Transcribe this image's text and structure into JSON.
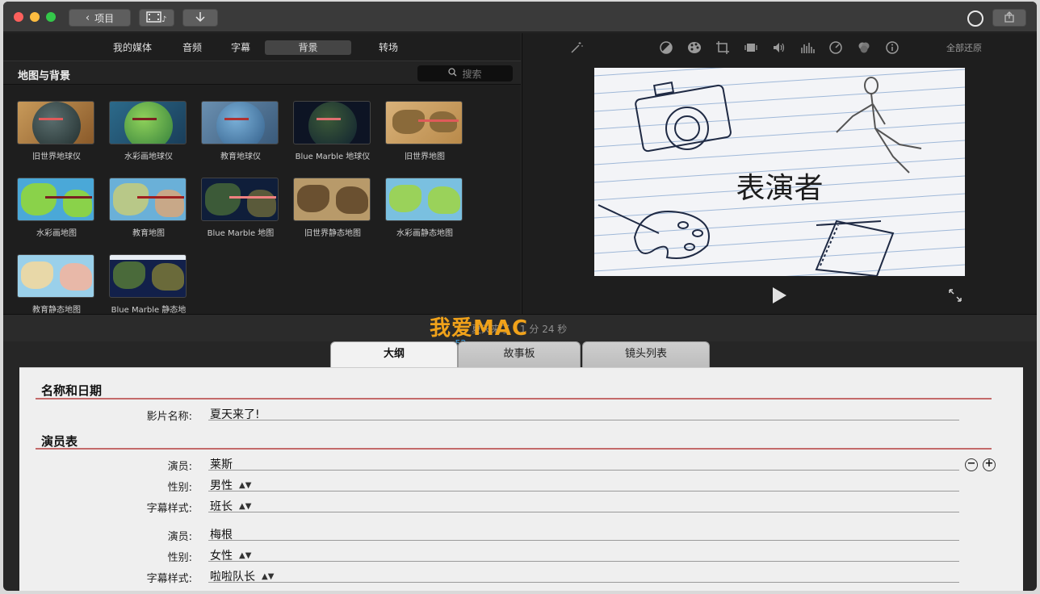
{
  "titlebar": {
    "back_label": "项目",
    "media_icon": "film-music-icon",
    "import_icon": "download-arrow-icon",
    "share_icon": "share-icon"
  },
  "browser": {
    "categories": [
      "我的媒体",
      "音频",
      "字幕",
      "背景",
      "转场"
    ],
    "active_category": "背景",
    "section_title": "地图与背景",
    "search_placeholder": "搜索",
    "tiles": [
      {
        "label": "旧世界地球仪"
      },
      {
        "label": "水彩画地球仪"
      },
      {
        "label": "教育地球仪"
      },
      {
        "label": "Blue Marble 地球仪"
      },
      {
        "label": "旧世界地图"
      },
      {
        "label": "水彩画地图"
      },
      {
        "label": "教育地图"
      },
      {
        "label": "Blue Marble 地图"
      },
      {
        "label": "旧世界静态地图"
      },
      {
        "label": "水彩画静态地图"
      },
      {
        "label": "教育静态地图"
      },
      {
        "label": "Blue Marble 静态地"
      }
    ]
  },
  "viewer": {
    "tools": [
      "magic-wand-icon",
      "color-balance-icon",
      "color-palette-icon",
      "crop-icon",
      "stabilization-icon",
      "volume-icon",
      "equalizer-icon",
      "speed-icon",
      "filter-icon",
      "info-icon"
    ],
    "reset_all": "全部还原",
    "preview_title": "表演者"
  },
  "strip": {
    "duration": "夏天来了 - 1 分 24 秒",
    "watermark_big": "我爱MAC",
    "watermark_small": "www.52mac.com"
  },
  "trailer_tabs": [
    "大纲",
    "故事板",
    "镜头列表"
  ],
  "outline": {
    "section_name_date": "名称和日期",
    "movie_name_label": "影片名称:",
    "movie_name_value": "夏天来了!",
    "section_cast": "演员表",
    "cast": [
      {
        "actor_label": "演员:",
        "actor": "莱斯",
        "gender_label": "性别:",
        "gender": "男性",
        "style_label": "字幕样式:",
        "style": "班长"
      },
      {
        "actor_label": "演员:",
        "actor": "梅根",
        "gender_label": "性别:",
        "gender": "女性",
        "style_label": "字幕样式:",
        "style": "啦啦队长"
      }
    ]
  }
}
